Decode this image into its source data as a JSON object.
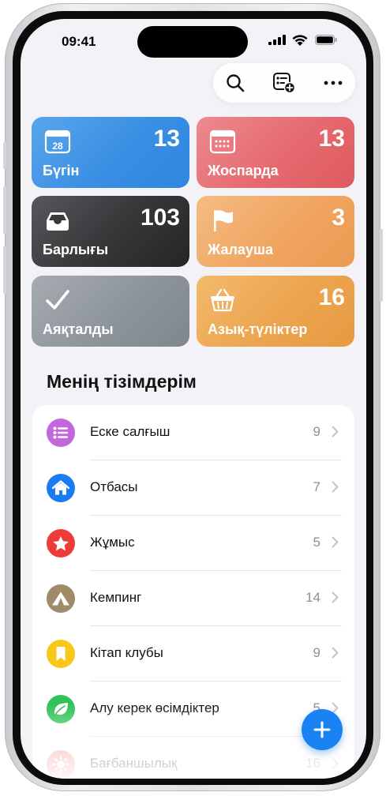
{
  "status_bar": {
    "time": "09:41"
  },
  "smart_lists": [
    {
      "label": "Бүгін",
      "count": "13",
      "icon": "calendar-today-icon",
      "day": "28"
    },
    {
      "label": "Жоспарда",
      "count": "13",
      "icon": "calendar-grid-icon"
    },
    {
      "label": "Барлығы",
      "count": "103",
      "icon": "tray-icon"
    },
    {
      "label": "Жалауша",
      "count": "3",
      "icon": "flag-icon"
    },
    {
      "label": "Аяқталды",
      "count": "",
      "icon": "checkmark-icon"
    },
    {
      "label": "Азық-түліктер",
      "count": "16",
      "icon": "basket-icon"
    }
  ],
  "section": {
    "title": "Менің тізімдерім"
  },
  "lists": [
    {
      "name": "Еске салғыш",
      "count": "9",
      "icon": "bullet-list-icon",
      "color": "#c268dc"
    },
    {
      "name": "Отбасы",
      "count": "7",
      "icon": "house-icon",
      "color": "#1a7cf2"
    },
    {
      "name": "Жұмыс",
      "count": "5",
      "icon": "star-icon",
      "color": "#ee3b37"
    },
    {
      "name": "Кемпинг",
      "count": "14",
      "icon": "tent-icon",
      "color": "#a08a68"
    },
    {
      "name": "Кітап клубы",
      "count": "9",
      "icon": "bookmark-icon",
      "color": "#f7c71a"
    },
    {
      "name": "Алу керек өсімдіктер",
      "count": "5",
      "icon": "leaf-icon",
      "color": "#33c25a"
    },
    {
      "name": "Бағбаншылық",
      "count": "16",
      "icon": "sun-icon",
      "color": "#f48c8c"
    }
  ],
  "colors": {
    "today": "#3a8fe3",
    "scheduled": "#e56a6f",
    "all": "#2e2e30",
    "flagged": "#f0a560",
    "completed": "#8d949b",
    "groceries": "#eca44e",
    "accent": "#1a82f3"
  }
}
